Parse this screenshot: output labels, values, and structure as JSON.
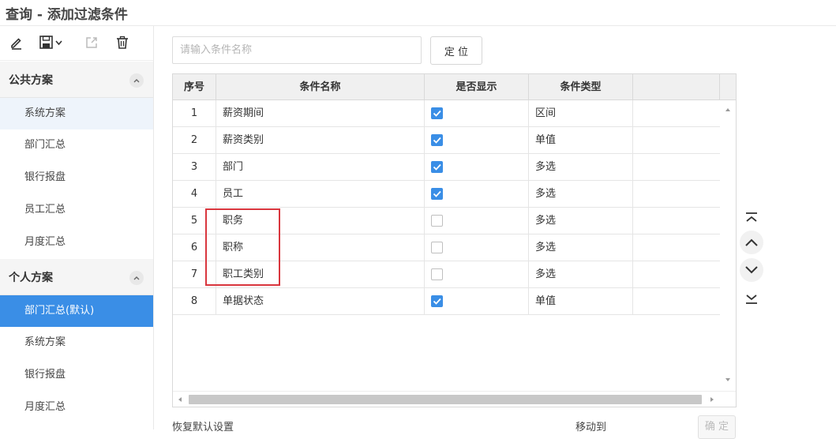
{
  "window": {
    "title": "查询 - 添加过滤条件"
  },
  "toolbar": {
    "icons": [
      "edit-icon",
      "save-dropdown-icon",
      "export-icon",
      "delete-icon"
    ]
  },
  "sidebar": {
    "public_section": {
      "title": "公共方案",
      "items": [
        "系统方案",
        "部门汇总",
        "银行报盘",
        "员工汇总",
        "月度汇总"
      ]
    },
    "personal_section": {
      "title": "个人方案",
      "items": [
        "部门汇总(默认)",
        "系统方案",
        "银行报盘",
        "月度汇总"
      ]
    }
  },
  "search": {
    "placeholder": "请输入条件名称",
    "value": "",
    "button_label": "定 位"
  },
  "grid": {
    "columns": [
      "序号",
      "条件名称",
      "是否显示",
      "条件类型",
      ""
    ],
    "rows": [
      {
        "num": "1",
        "name": "薪资期间",
        "shown": true,
        "type": "区间"
      },
      {
        "num": "2",
        "name": "薪资类别",
        "shown": true,
        "type": "单值"
      },
      {
        "num": "3",
        "name": "部门",
        "shown": true,
        "type": "多选"
      },
      {
        "num": "4",
        "name": "员工",
        "shown": true,
        "type": "多选"
      },
      {
        "num": "5",
        "name": "职务",
        "shown": false,
        "type": "多选"
      },
      {
        "num": "6",
        "name": "职称",
        "shown": false,
        "type": "多选"
      },
      {
        "num": "7",
        "name": "职工类别",
        "shown": false,
        "type": "多选"
      },
      {
        "num": "8",
        "name": "单据状态",
        "shown": true,
        "type": "单值"
      }
    ]
  },
  "footer": {
    "restore_label": "恢复默认设置",
    "move_label": "移动到",
    "ok_label": "确 定"
  },
  "colors": {
    "accent": "#3a8ee6",
    "highlight_border": "#d9363e"
  }
}
